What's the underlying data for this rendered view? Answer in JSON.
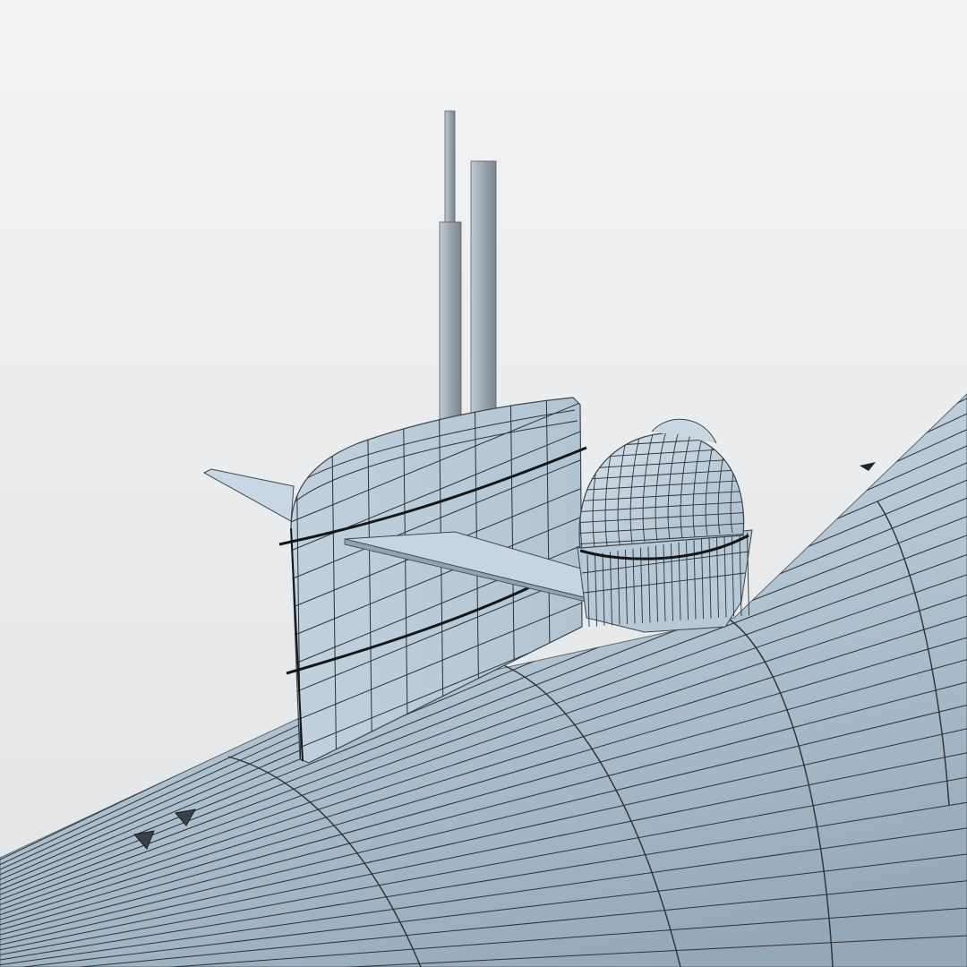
{
  "scene": {
    "subject": "submarine-wireframe-render",
    "colors": {
      "background_top": "#f2f3f4",
      "background_bottom": "#e2e4e6",
      "hull_light": "#c7d6e2",
      "hull_mid": "#a9bccb",
      "hull_dark": "#8ea3b4",
      "wire": "#2c3136",
      "band": "#141618",
      "mast_light": "#b9c3cb",
      "mast_dark": "#7f8a93"
    }
  }
}
